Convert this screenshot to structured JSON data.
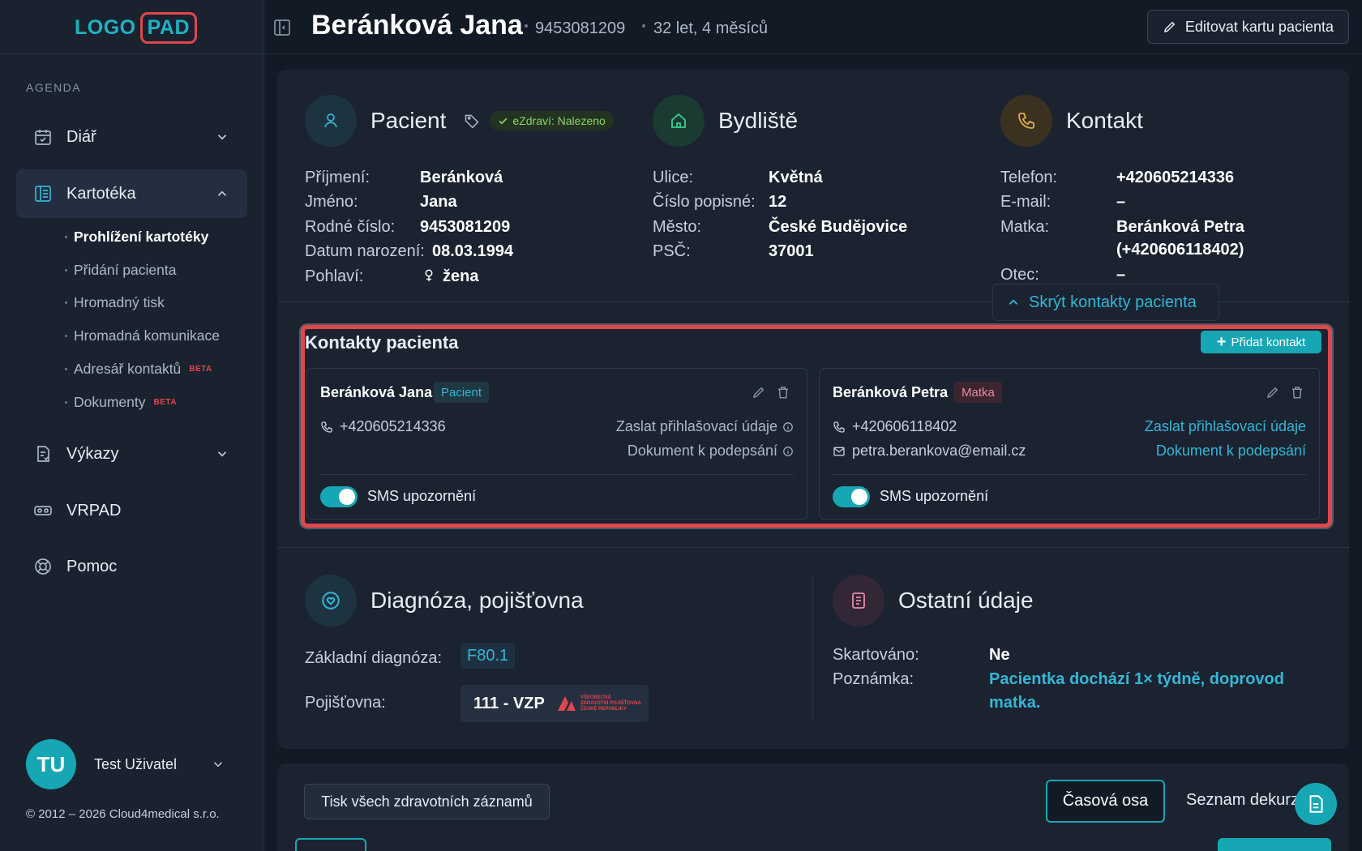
{
  "logo": {
    "part1": "LOGO",
    "part2": "PAD"
  },
  "sidebar": {
    "section_label": "AGENDA",
    "items": [
      {
        "label": "Diář",
        "icon": "calendar-icon"
      },
      {
        "label": "Kartotéka",
        "icon": "card-file-icon"
      },
      {
        "label": "Výkazy",
        "icon": "report-icon"
      },
      {
        "label": "VRPAD",
        "icon": "vr-headset-icon"
      },
      {
        "label": "Pomoc",
        "icon": "lifebuoy-icon"
      }
    ],
    "subitems": [
      {
        "label": "Prohlížení kartotéky"
      },
      {
        "label": "Přidání pacienta"
      },
      {
        "label": "Hromadný tisk"
      },
      {
        "label": "Hromadná komunikace"
      },
      {
        "label": "Adresář kontaktů",
        "badge": "BETA"
      },
      {
        "label": "Dokumenty",
        "badge": "BETA"
      }
    ],
    "user": {
      "initials": "TU",
      "name": "Test Uživatel"
    },
    "copyright": "© 2012 – 2026 Cloud4medical s.r.o."
  },
  "header": {
    "patient_name": "Beránková Jana",
    "birth_number": "9453081209",
    "age": "32 let, 4 měsíců",
    "edit_label": "Editovat kartu pacienta"
  },
  "patient": {
    "title": "Pacient",
    "ezdravi": "eZdraví: Nalezeno",
    "labels": {
      "surname": "Příjmení:",
      "name": "Jméno:",
      "birth_number": "Rodné číslo:",
      "birth_date": "Datum narození:",
      "sex": "Pohlaví:"
    },
    "values": {
      "surname": "Beránková",
      "name": "Jana",
      "birth_number": "9453081209",
      "birth_date": "08.03.1994",
      "sex": "žena"
    }
  },
  "address": {
    "title": "Bydliště",
    "labels": {
      "street": "Ulice:",
      "number": "Číslo popisné:",
      "city": "Město:",
      "zip": "PSČ:"
    },
    "values": {
      "street": "Květná",
      "number": "12",
      "city": "České Budějovice",
      "zip": "37001"
    }
  },
  "contact": {
    "title": "Kontakt",
    "labels": {
      "phone": "Telefon:",
      "email": "E-mail:",
      "mother": "Matka:",
      "father": "Otec:"
    },
    "values": {
      "phone": "+420605214336",
      "email": "–",
      "mother_name": "Beránková Petra",
      "mother_phone": "(+420606118402)",
      "father": "–"
    },
    "hide_label": "Skrýt kontakty pacienta"
  },
  "contacts_section": {
    "title": "Kontakty pacienta",
    "add_label": "Přidat kontakt",
    "cards": [
      {
        "name": "Beránková Jana",
        "role": "Pacient",
        "phone": "+420605214336",
        "email": "",
        "send_login": "Zaslat přihlašovací údaje",
        "sign_doc": "Dokument k podepsání",
        "sms": "SMS upozornění",
        "sms_on": true
      },
      {
        "name": "Beránková Petra",
        "role": "Matka",
        "phone": "+420606118402",
        "email": "petra.berankova@email.cz",
        "send_login": "Zaslat přihlašovací údaje",
        "sign_doc": "Dokument k podepsání",
        "sms": "SMS upozornění",
        "sms_on": true
      }
    ]
  },
  "diagnosis": {
    "title": "Diagnóza, pojišťovna",
    "diag_label": "Základní diagnóza:",
    "diag_value": "F80.1",
    "ins_label": "Pojišťovna:",
    "ins_value": "111 - VZP",
    "ins_logo_lines": [
      "VŠEOBECNÁ",
      "ZDRAVOTNÍ POJIŠŤOVNA",
      "ČESKÉ REPUBLIKY"
    ]
  },
  "other": {
    "title": "Ostatní údaje",
    "shred_label": "Skartováno:",
    "shred_value": "Ne",
    "note_label": "Poznámka:",
    "note_value": "Pacientka dochází 1× týdně, doprovod matka."
  },
  "bottom": {
    "print_label": "Tisk všech zdravotních záznamů",
    "timeline_label": "Časová osa",
    "list_label": "Seznam dekurzů"
  },
  "colors": {
    "accent": "#17a7b4",
    "highlight": "#e0474c",
    "background": "#121a25",
    "card": "#1b2331"
  }
}
